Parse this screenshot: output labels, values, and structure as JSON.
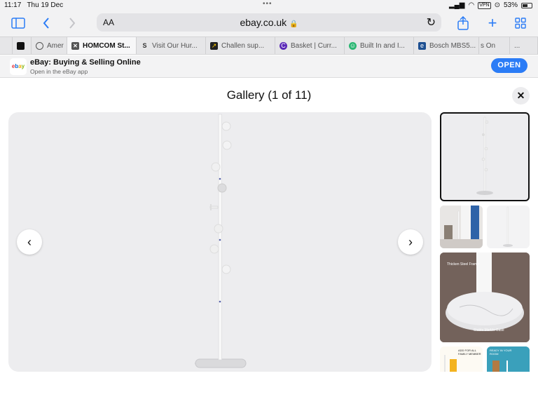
{
  "status": {
    "time": "11:17",
    "date": "Thu 19 Dec",
    "vpn": "VPN",
    "battery": "53%"
  },
  "browser": {
    "url": "ebay.co.uk",
    "aa": "AA",
    "tabs": [
      {
        "label": "Amer",
        "favicon": "globe"
      },
      {
        "label": "HOMCOM St...",
        "favicon": "close",
        "active": true
      },
      {
        "label": "Visit Our Hur...",
        "favicon": "s-logo"
      },
      {
        "label": "Challen sup...",
        "favicon": "chart-logo"
      },
      {
        "label": "Basket | Curr...",
        "favicon": "c-logo"
      },
      {
        "label": "Built In and I...",
        "favicon": "smile-logo"
      },
      {
        "label": "Bosch MBS5...",
        "favicon": "e-logo"
      },
      {
        "label": "s On",
        "favicon": ""
      },
      {
        "label": "...",
        "favicon": ""
      }
    ]
  },
  "banner": {
    "logo": "ebay",
    "title": "eBay: Buying & Selling Online",
    "subtitle": "Open in the eBay app",
    "open_label": "OPEN"
  },
  "gallery": {
    "title": "Gallery (1 of 11)"
  },
  "thumbs": {
    "t4a_caption": "Thicken Steel Frame",
    "t4b_caption": "Stable Marble Base",
    "t5_caption": "ADD FOR ALL FAMILY MEMBER",
    "t6_caption": "READY IN YOUR ROOM"
  },
  "colors": {
    "accent": "#2b7cf6",
    "close_bg": "#ececee",
    "main_bg": "#ededef"
  }
}
